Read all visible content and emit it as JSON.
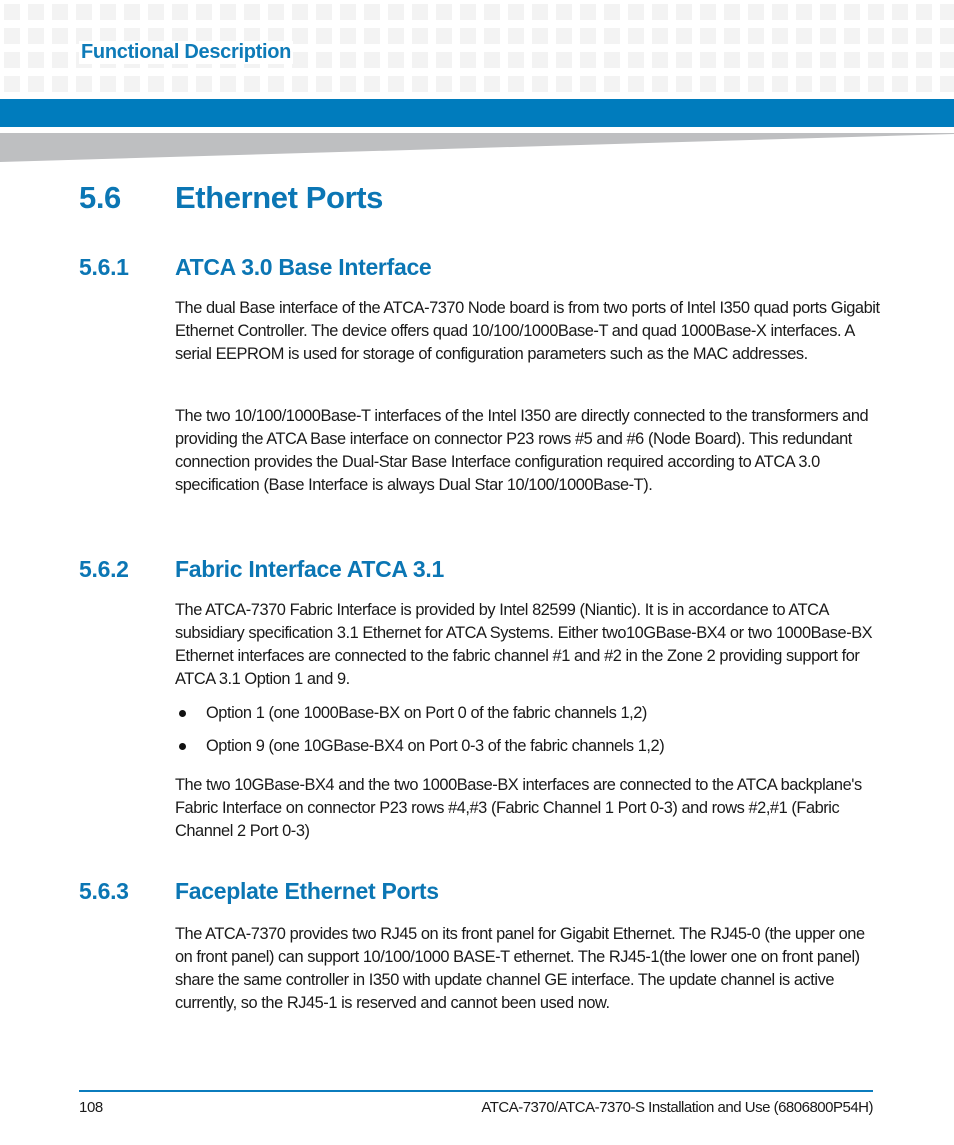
{
  "header": {
    "section_title": "Functional Description",
    "colors": {
      "accent_blue": "#007cbd",
      "heading_blue": "#0b76b4",
      "grid_gray": "#f3f3f3",
      "wedge_gray": "#bebfc1"
    }
  },
  "section": {
    "number": "5.6",
    "title": "Ethernet Ports"
  },
  "subsections": [
    {
      "number": "5.6.1",
      "title": "ATCA 3.0 Base Interface",
      "paragraphs": [
        "The dual Base interface of the ATCA-7370 Node board is from two ports of Intel I350 quad ports Gigabit Ethernet Controller. The device offers quad 10/100/1000Base-T and quad 1000Base-X interfaces. A serial EEPROM is used for storage of configuration parameters such as the MAC addresses.",
        "The two 10/100/1000Base-T interfaces of the Intel I350 are directly connected to the transformers and providing the ATCA Base interface on connector P23 rows #5 and #6 (Node Board). This redundant connection provides the Dual-Star Base Interface configuration required according to ATCA 3.0 specification (Base Interface is always Dual Star 10/100/1000Base-T)."
      ]
    },
    {
      "number": "5.6.2",
      "title": "Fabric Interface ATCA 3.1",
      "paragraphs": [
        "The ATCA-7370 Fabric Interface is provided by Intel 82599 (Niantic). It is in accordance to ATCA subsidiary specification 3.1 Ethernet for ATCA Systems. Either two10GBase-BX4 or two 1000Base-BX Ethernet interfaces are connected to the fabric channel #1 and #2 in the Zone 2 providing support for ATCA 3.1 Option 1 and 9.",
        "The two 10GBase-BX4 and the two 1000Base-BX interfaces are connected to the ATCA backplane's Fabric Interface on connector P23 rows #4,#3 (Fabric Channel 1 Port 0-3) and rows #2,#1 (Fabric Channel 2 Port 0-3)"
      ],
      "bullets": [
        "Option 1 (one 1000Base-BX on Port 0 of the fabric channels 1,2)",
        "Option 9 (one 10GBase-BX4 on Port 0-3 of the fabric channels 1,2)"
      ]
    },
    {
      "number": "5.6.3",
      "title": "Faceplate Ethernet Ports",
      "paragraphs": [
        "The ATCA-7370 provides two RJ45 on its front panel for Gigabit Ethernet. The RJ45-0 (the upper one on front panel) can support 10/100/1000 BASE-T ethernet. The RJ45-1(the lower one on front panel) share the same controller in I350 with update channel GE interface. The update channel is active currently, so the RJ45-1 is reserved and cannot been used now."
      ]
    }
  ],
  "footer": {
    "page_number": "108",
    "document_title": "ATCA-7370/ATCA-7370-S Installation and Use (6806800P54H)"
  }
}
